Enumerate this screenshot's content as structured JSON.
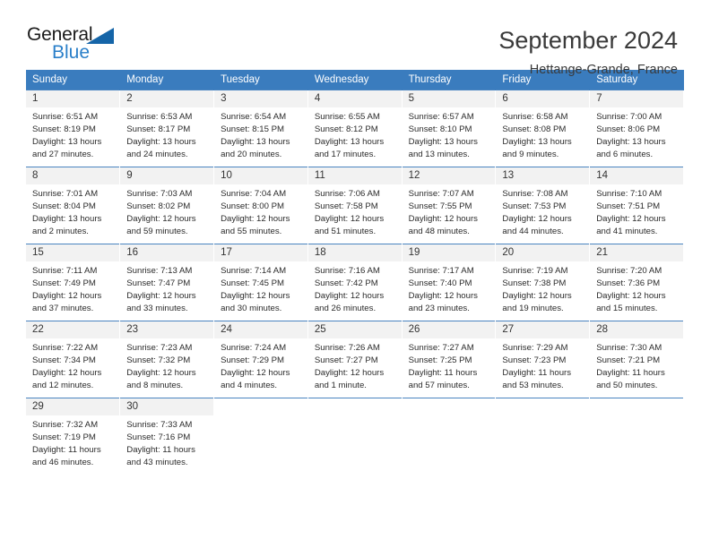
{
  "logo": {
    "word_one": "General",
    "word_two": "Blue",
    "triangle_color": "#1565a8",
    "blue_color": "#2a7fc9"
  },
  "header": {
    "title": "September 2024",
    "subtitle": "Hettange-Grande, France"
  },
  "theme": {
    "header_bg": "#3a7cbe",
    "daynum_bg": "#f2f2f2",
    "grid_line": "#4a84c0"
  },
  "weekday_headers": [
    "Sunday",
    "Monday",
    "Tuesday",
    "Wednesday",
    "Thursday",
    "Friday",
    "Saturday"
  ],
  "weeks": [
    [
      {
        "day": "1",
        "sunrise": "Sunrise: 6:51 AM",
        "sunset": "Sunset: 8:19 PM",
        "daylight_line1": "Daylight: 13 hours",
        "daylight_line2": "and 27 minutes."
      },
      {
        "day": "2",
        "sunrise": "Sunrise: 6:53 AM",
        "sunset": "Sunset: 8:17 PM",
        "daylight_line1": "Daylight: 13 hours",
        "daylight_line2": "and 24 minutes."
      },
      {
        "day": "3",
        "sunrise": "Sunrise: 6:54 AM",
        "sunset": "Sunset: 8:15 PM",
        "daylight_line1": "Daylight: 13 hours",
        "daylight_line2": "and 20 minutes."
      },
      {
        "day": "4",
        "sunrise": "Sunrise: 6:55 AM",
        "sunset": "Sunset: 8:12 PM",
        "daylight_line1": "Daylight: 13 hours",
        "daylight_line2": "and 17 minutes."
      },
      {
        "day": "5",
        "sunrise": "Sunrise: 6:57 AM",
        "sunset": "Sunset: 8:10 PM",
        "daylight_line1": "Daylight: 13 hours",
        "daylight_line2": "and 13 minutes."
      },
      {
        "day": "6",
        "sunrise": "Sunrise: 6:58 AM",
        "sunset": "Sunset: 8:08 PM",
        "daylight_line1": "Daylight: 13 hours",
        "daylight_line2": "and 9 minutes."
      },
      {
        "day": "7",
        "sunrise": "Sunrise: 7:00 AM",
        "sunset": "Sunset: 8:06 PM",
        "daylight_line1": "Daylight: 13 hours",
        "daylight_line2": "and 6 minutes."
      }
    ],
    [
      {
        "day": "8",
        "sunrise": "Sunrise: 7:01 AM",
        "sunset": "Sunset: 8:04 PM",
        "daylight_line1": "Daylight: 13 hours",
        "daylight_line2": "and 2 minutes."
      },
      {
        "day": "9",
        "sunrise": "Sunrise: 7:03 AM",
        "sunset": "Sunset: 8:02 PM",
        "daylight_line1": "Daylight: 12 hours",
        "daylight_line2": "and 59 minutes."
      },
      {
        "day": "10",
        "sunrise": "Sunrise: 7:04 AM",
        "sunset": "Sunset: 8:00 PM",
        "daylight_line1": "Daylight: 12 hours",
        "daylight_line2": "and 55 minutes."
      },
      {
        "day": "11",
        "sunrise": "Sunrise: 7:06 AM",
        "sunset": "Sunset: 7:58 PM",
        "daylight_line1": "Daylight: 12 hours",
        "daylight_line2": "and 51 minutes."
      },
      {
        "day": "12",
        "sunrise": "Sunrise: 7:07 AM",
        "sunset": "Sunset: 7:55 PM",
        "daylight_line1": "Daylight: 12 hours",
        "daylight_line2": "and 48 minutes."
      },
      {
        "day": "13",
        "sunrise": "Sunrise: 7:08 AM",
        "sunset": "Sunset: 7:53 PM",
        "daylight_line1": "Daylight: 12 hours",
        "daylight_line2": "and 44 minutes."
      },
      {
        "day": "14",
        "sunrise": "Sunrise: 7:10 AM",
        "sunset": "Sunset: 7:51 PM",
        "daylight_line1": "Daylight: 12 hours",
        "daylight_line2": "and 41 minutes."
      }
    ],
    [
      {
        "day": "15",
        "sunrise": "Sunrise: 7:11 AM",
        "sunset": "Sunset: 7:49 PM",
        "daylight_line1": "Daylight: 12 hours",
        "daylight_line2": "and 37 minutes."
      },
      {
        "day": "16",
        "sunrise": "Sunrise: 7:13 AM",
        "sunset": "Sunset: 7:47 PM",
        "daylight_line1": "Daylight: 12 hours",
        "daylight_line2": "and 33 minutes."
      },
      {
        "day": "17",
        "sunrise": "Sunrise: 7:14 AM",
        "sunset": "Sunset: 7:45 PM",
        "daylight_line1": "Daylight: 12 hours",
        "daylight_line2": "and 30 minutes."
      },
      {
        "day": "18",
        "sunrise": "Sunrise: 7:16 AM",
        "sunset": "Sunset: 7:42 PM",
        "daylight_line1": "Daylight: 12 hours",
        "daylight_line2": "and 26 minutes."
      },
      {
        "day": "19",
        "sunrise": "Sunrise: 7:17 AM",
        "sunset": "Sunset: 7:40 PM",
        "daylight_line1": "Daylight: 12 hours",
        "daylight_line2": "and 23 minutes."
      },
      {
        "day": "20",
        "sunrise": "Sunrise: 7:19 AM",
        "sunset": "Sunset: 7:38 PM",
        "daylight_line1": "Daylight: 12 hours",
        "daylight_line2": "and 19 minutes."
      },
      {
        "day": "21",
        "sunrise": "Sunrise: 7:20 AM",
        "sunset": "Sunset: 7:36 PM",
        "daylight_line1": "Daylight: 12 hours",
        "daylight_line2": "and 15 minutes."
      }
    ],
    [
      {
        "day": "22",
        "sunrise": "Sunrise: 7:22 AM",
        "sunset": "Sunset: 7:34 PM",
        "daylight_line1": "Daylight: 12 hours",
        "daylight_line2": "and 12 minutes."
      },
      {
        "day": "23",
        "sunrise": "Sunrise: 7:23 AM",
        "sunset": "Sunset: 7:32 PM",
        "daylight_line1": "Daylight: 12 hours",
        "daylight_line2": "and 8 minutes."
      },
      {
        "day": "24",
        "sunrise": "Sunrise: 7:24 AM",
        "sunset": "Sunset: 7:29 PM",
        "daylight_line1": "Daylight: 12 hours",
        "daylight_line2": "and 4 minutes."
      },
      {
        "day": "25",
        "sunrise": "Sunrise: 7:26 AM",
        "sunset": "Sunset: 7:27 PM",
        "daylight_line1": "Daylight: 12 hours",
        "daylight_line2": "and 1 minute."
      },
      {
        "day": "26",
        "sunrise": "Sunrise: 7:27 AM",
        "sunset": "Sunset: 7:25 PM",
        "daylight_line1": "Daylight: 11 hours",
        "daylight_line2": "and 57 minutes."
      },
      {
        "day": "27",
        "sunrise": "Sunrise: 7:29 AM",
        "sunset": "Sunset: 7:23 PM",
        "daylight_line1": "Daylight: 11 hours",
        "daylight_line2": "and 53 minutes."
      },
      {
        "day": "28",
        "sunrise": "Sunrise: 7:30 AM",
        "sunset": "Sunset: 7:21 PM",
        "daylight_line1": "Daylight: 11 hours",
        "daylight_line2": "and 50 minutes."
      }
    ],
    [
      {
        "day": "29",
        "sunrise": "Sunrise: 7:32 AM",
        "sunset": "Sunset: 7:19 PM",
        "daylight_line1": "Daylight: 11 hours",
        "daylight_line2": "and 46 minutes."
      },
      {
        "day": "30",
        "sunrise": "Sunrise: 7:33 AM",
        "sunset": "Sunset: 7:16 PM",
        "daylight_line1": "Daylight: 11 hours",
        "daylight_line2": "and 43 minutes."
      },
      {
        "day": "",
        "sunrise": "",
        "sunset": "",
        "daylight_line1": "",
        "daylight_line2": ""
      },
      {
        "day": "",
        "sunrise": "",
        "sunset": "",
        "daylight_line1": "",
        "daylight_line2": ""
      },
      {
        "day": "",
        "sunrise": "",
        "sunset": "",
        "daylight_line1": "",
        "daylight_line2": ""
      },
      {
        "day": "",
        "sunrise": "",
        "sunset": "",
        "daylight_line1": "",
        "daylight_line2": ""
      },
      {
        "day": "",
        "sunrise": "",
        "sunset": "",
        "daylight_line1": "",
        "daylight_line2": ""
      }
    ]
  ]
}
